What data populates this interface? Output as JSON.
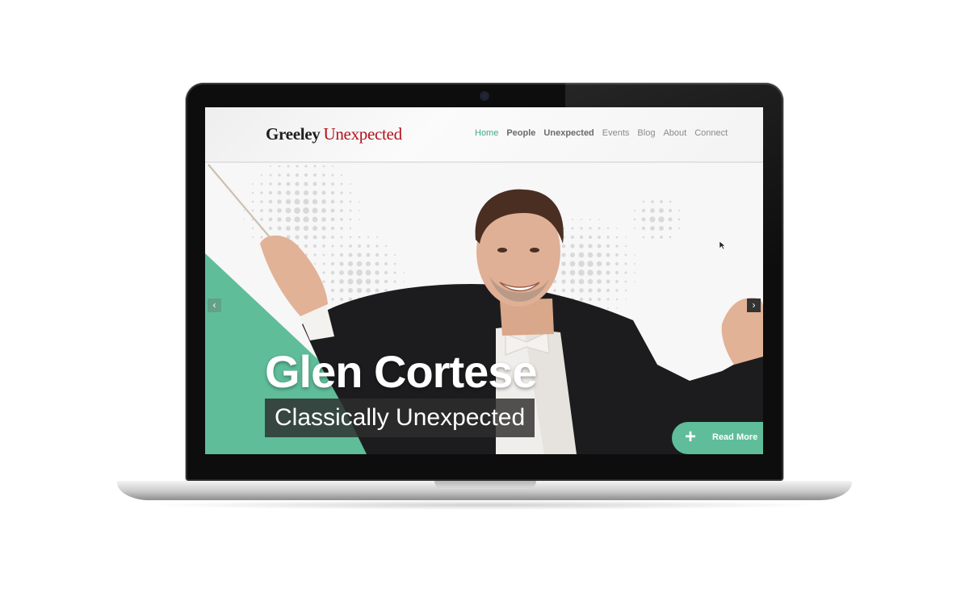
{
  "site": {
    "logo_strong": "Greeley",
    "logo_accent": "Unexpected",
    "nav": [
      {
        "label": "Home",
        "state": "active"
      },
      {
        "label": "People",
        "state": "bold"
      },
      {
        "label": "Unexpected",
        "state": "bold"
      },
      {
        "label": "Events",
        "state": "normal"
      },
      {
        "label": "Blog",
        "state": "normal"
      },
      {
        "label": "About",
        "state": "normal"
      },
      {
        "label": "Connect",
        "state": "normal"
      }
    ]
  },
  "hero": {
    "title": "Glen Cortese",
    "subtitle": "Classically Unexpected",
    "read_more_label": "Read More",
    "read_more_icon": "plus-icon",
    "prev_icon": "chevron-left-icon",
    "next_icon": "chevron-right-icon",
    "prev_glyph": "‹",
    "next_glyph": "›",
    "plus_glyph": "+"
  },
  "colors": {
    "accent_green": "#5fbd9a",
    "logo_red": "#b3121c",
    "nav_active": "#45a88a"
  }
}
